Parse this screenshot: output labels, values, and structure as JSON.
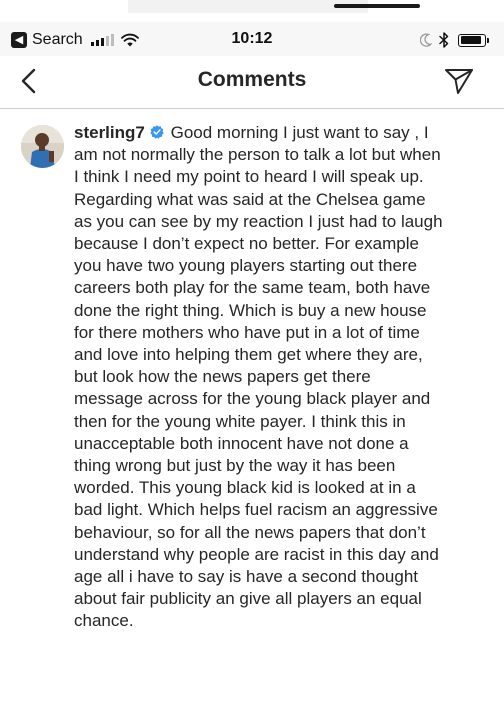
{
  "status_bar": {
    "back_app_label": "Search",
    "time": "10:12",
    "battery_level": 0.92
  },
  "header": {
    "title": "Comments"
  },
  "comment": {
    "username": "sterling7",
    "verified": true,
    "text": "Good morning I just want to say , I am not normally the person to talk a lot but when I think I need my point to heard I will speak up. Regarding what was said at the Chelsea game as you can see by my reaction I just had to laugh because I don’t expect no better. For example you have two young players starting out there careers both play for the same team, both have done the right thing. Which is buy a new house for there mothers who have put in a lot of time and love into helping them get where they are, but look how the news papers get there message across for the young black player and then for the young white payer. I think this in unacceptable both innocent have not done a thing wrong but just by the way it has been worded. This young black kid is looked at in a bad light. Which helps fuel racism an aggressive behaviour, so for all the news papers that don’t understand why people are racist in this day and age all i have to say is have a second thought about fair publicity an give all players an equal chance."
  },
  "colors": {
    "verified_blue": "#3897f0",
    "text": "#262626",
    "divider": "#cfcfcf",
    "status_bar_bg": "#f7f7f7"
  },
  "icons": {
    "back_app": "back-to-app-icon",
    "signal": "cellular-signal-icon",
    "wifi": "wifi-icon",
    "moon": "do-not-disturb-moon-icon",
    "bluetooth": "bluetooth-icon",
    "battery": "battery-icon",
    "back": "chevron-left-icon",
    "send": "paper-plane-icon",
    "verified": "verified-badge-icon"
  }
}
